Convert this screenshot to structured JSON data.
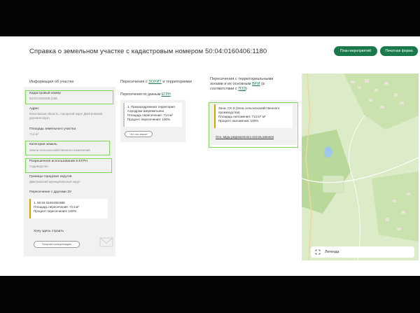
{
  "title": "Справка о земельном участке с кадастровым номером 50:04:0160406:1180",
  "buttons": {
    "plan": "План мероприятий",
    "print": "Печатная форма"
  },
  "col1": {
    "heading": "Информация об участке",
    "cadastral_label": "Кадастровый номер",
    "cadastral_value": "50:04:0160406:1180",
    "address_label": "Адрес",
    "address_value": "Московская область, городской округ Дмитровский, деревня Шуко",
    "area_label": "Площадь земельного участка",
    "area_value": "714 м²",
    "category_label": "Категория земель",
    "category_value": "Земли сельскохозяйственного назначения",
    "use_label": "Разрешенное использование в ЕГРН",
    "use_value": "Садоводство",
    "borders_label": "Границы городских округов",
    "borders_value": "Дмитровский муниципальный округ",
    "cross_label": "Пересечение с другими ЗУ",
    "cross_card": {
      "id": "1. 50:04:0160406:888",
      "area": "Площадь пересечения: 714 м²",
      "percent": "Процент пересечения: 100%"
    },
    "build_text": "Хочу здесь строить",
    "consult_button": "Получить консультацию"
  },
  "col2": {
    "heading_prefix": "Пересечения с ",
    "heading_link": "ЗОУИТ",
    "heading_suffix": " и территориями",
    "data_prefix": "Пересечения по данным ",
    "data_link": "ЕГРН",
    "card": {
      "name": "1. Приаэродромная территория Аэродром Шереметьево",
      "area": "Площадь пересечения: 714 м²",
      "percent": "Процент пересечения: 100%"
    },
    "details_button": "Что это значит"
  },
  "col3": {
    "heading_line1": "Пересечения с территориальными",
    "heading_line2_prefix": "зонами и их основным ",
    "heading_link": "ВРИ",
    "heading_line2_suffix": " (в",
    "heading_line3_prefix": "соответствии с ",
    "heading_link2": "ПЗЗ",
    "heading_line3_suffix": ")",
    "zone": "Зона: СХ-3 (Зона сельскохозяйственного производства)",
    "area": "Площадь наложения: 713.57 м²",
    "percent": "Процент наложения: 100%",
    "link": "Осн. виды разрешенного использования"
  },
  "map": {
    "legend": "Легенда"
  },
  "colors": {
    "accent": "#1b7a4c",
    "highlight": "#7ed957",
    "card_border": "#d9a400"
  }
}
